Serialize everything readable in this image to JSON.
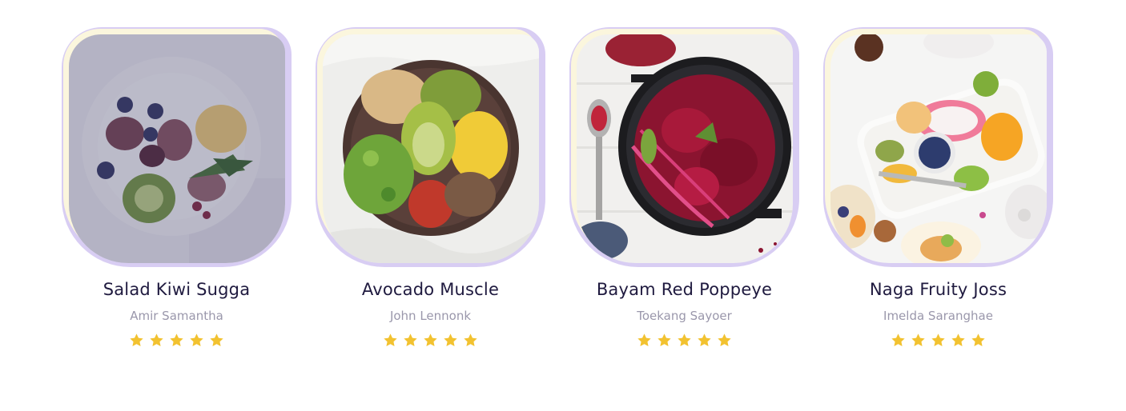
{
  "colors": {
    "frame_accent": "#d8cdf3",
    "frame_inner": "#fbf6dd",
    "title": "#1f1a3f",
    "author": "#9a97ab",
    "star": "#f2c230"
  },
  "recipes": [
    {
      "title": "Salad Kiwi Sugga",
      "author": "Amir Samantha",
      "rating": 5,
      "max_rating": 5
    },
    {
      "title": "Avocado Muscle",
      "author": "John Lennonk",
      "rating": 5,
      "max_rating": 5
    },
    {
      "title": "Bayam Red Poppeye",
      "author": "Toekang Sayoer",
      "rating": 5,
      "max_rating": 5
    },
    {
      "title": "Naga Fruity Joss",
      "author": "Imelda Saranghae",
      "rating": 5,
      "max_rating": 5
    }
  ]
}
